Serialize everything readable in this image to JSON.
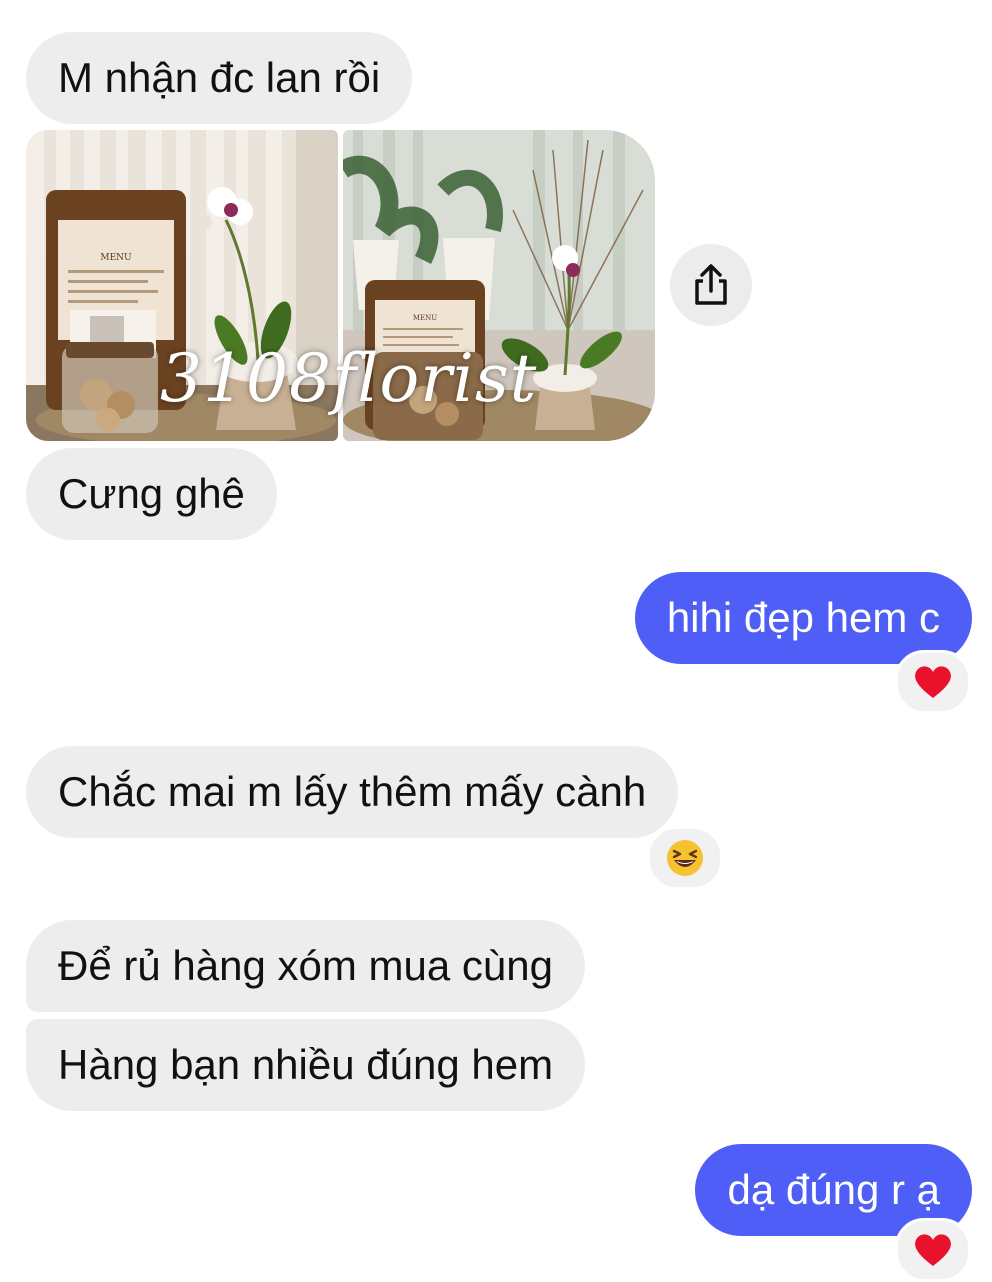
{
  "messages": {
    "m1": "M nhận đc lan rồi",
    "m2": "Cưng ghê",
    "m3": "hihi đẹp hem c",
    "m4": "Chắc mai m lấy thêm mấy cành",
    "m5": "Để rủ hàng xóm mua cùng",
    "m6": "Hàng bạn nhiều đúng hem",
    "m7": "dạ đúng r ạ"
  },
  "photos": {
    "watermark": "3108florist",
    "caption_1": "MENU",
    "caption_2": "MENU"
  },
  "icons": {
    "share": "share-icon",
    "heart": "heart-emoji",
    "laugh": "laughing-emoji"
  },
  "colors": {
    "incoming_bubble": "#ededed",
    "outgoing_bubble": "#4f5ef6",
    "heart": "#e8122d"
  }
}
